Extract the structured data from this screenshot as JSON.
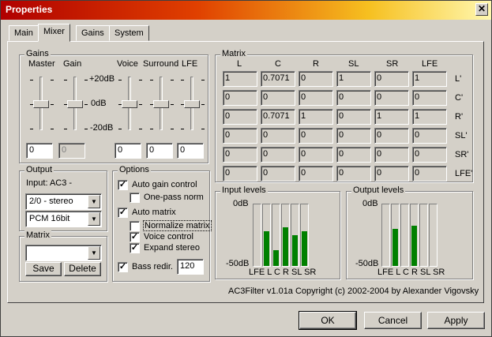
{
  "window": {
    "title": "Properties",
    "close_glyph": "✕"
  },
  "tabs": [
    {
      "label": "Main"
    },
    {
      "label": "Mixer"
    },
    {
      "label": "Gains"
    },
    {
      "label": "System"
    }
  ],
  "gains": {
    "legend": "Gains",
    "labels": {
      "master": "Master",
      "gain": "Gain",
      "voice": "Voice",
      "surround": "Surround",
      "lfe": "LFE"
    },
    "scale": {
      "plus": "+20dB",
      "zero": "0dB",
      "minus": "-20dB"
    },
    "values": {
      "master": "0",
      "gain": "0",
      "voice": "0",
      "surround": "0",
      "lfe": "0"
    },
    "slider_levels_db": {
      "master": 0,
      "gain": 0,
      "voice": 0,
      "surround": 0,
      "lfe": 0
    }
  },
  "output": {
    "legend": "Output",
    "input_label": "Input: AC3 -",
    "channel_select": "2/0 - stereo",
    "format_select": "PCM 16bit"
  },
  "options": {
    "legend": "Options",
    "auto_gain_control": {
      "label": "Auto gain control",
      "checked": true
    },
    "one_pass_norm": {
      "label": "One-pass norm",
      "checked": false
    },
    "auto_matrix": {
      "label": "Auto matrix",
      "checked": true
    },
    "normalize_matrix": {
      "label": "Normalize matrix",
      "checked": false
    },
    "voice_control": {
      "label": "Voice control",
      "checked": true
    },
    "expand_stereo": {
      "label": "Expand stereo",
      "checked": true
    },
    "bass_redir": {
      "label": "Bass redir.",
      "checked": true,
      "value": "120"
    }
  },
  "matrix_preset": {
    "legend": "Matrix",
    "select_value": "",
    "save_label": "Save",
    "delete_label": "Delete"
  },
  "matrix": {
    "legend": "Matrix",
    "columns": [
      "L",
      "C",
      "R",
      "SL",
      "SR",
      "LFE"
    ],
    "rows": [
      {
        "label": "L'",
        "cells": [
          "1",
          "0.7071",
          "0",
          "1",
          "0",
          "1"
        ]
      },
      {
        "label": "C'",
        "cells": [
          "0",
          "0",
          "0",
          "0",
          "0",
          "0"
        ]
      },
      {
        "label": "R'",
        "cells": [
          "0",
          "0.7071",
          "1",
          "0",
          "1",
          "1"
        ]
      },
      {
        "label": "SL'",
        "cells": [
          "0",
          "0",
          "0",
          "0",
          "0",
          "0"
        ]
      },
      {
        "label": "SR'",
        "cells": [
          "0",
          "0",
          "0",
          "0",
          "0",
          "0"
        ]
      },
      {
        "label": "LFE'",
        "cells": [
          "0",
          "0",
          "0",
          "0",
          "0",
          "0"
        ]
      }
    ]
  },
  "input_levels": {
    "legend": "Input levels",
    "top_label": "0dB",
    "bottom_label": "-50dB",
    "channels": [
      "LFE",
      "L",
      "C",
      "R",
      "SL",
      "SR"
    ],
    "levels": [
      0,
      0.56,
      0.25,
      0.63,
      0.5,
      0.56
    ]
  },
  "output_levels": {
    "legend": "Output levels",
    "top_label": "0dB",
    "bottom_label": "-50dB",
    "channels": [
      "LFE",
      "L",
      "C",
      "R",
      "SL",
      "SR"
    ],
    "levels": [
      0,
      0.6,
      0,
      0.65,
      0,
      0
    ]
  },
  "copyright": "AC3Filter v1.01a Copyright (c) 2002-2004 by Alexander Vigovsky",
  "buttons": {
    "ok": "OK",
    "cancel": "Cancel",
    "apply": "Apply"
  },
  "colors": {
    "meter": "#008000",
    "face": "#d4d0c8"
  }
}
